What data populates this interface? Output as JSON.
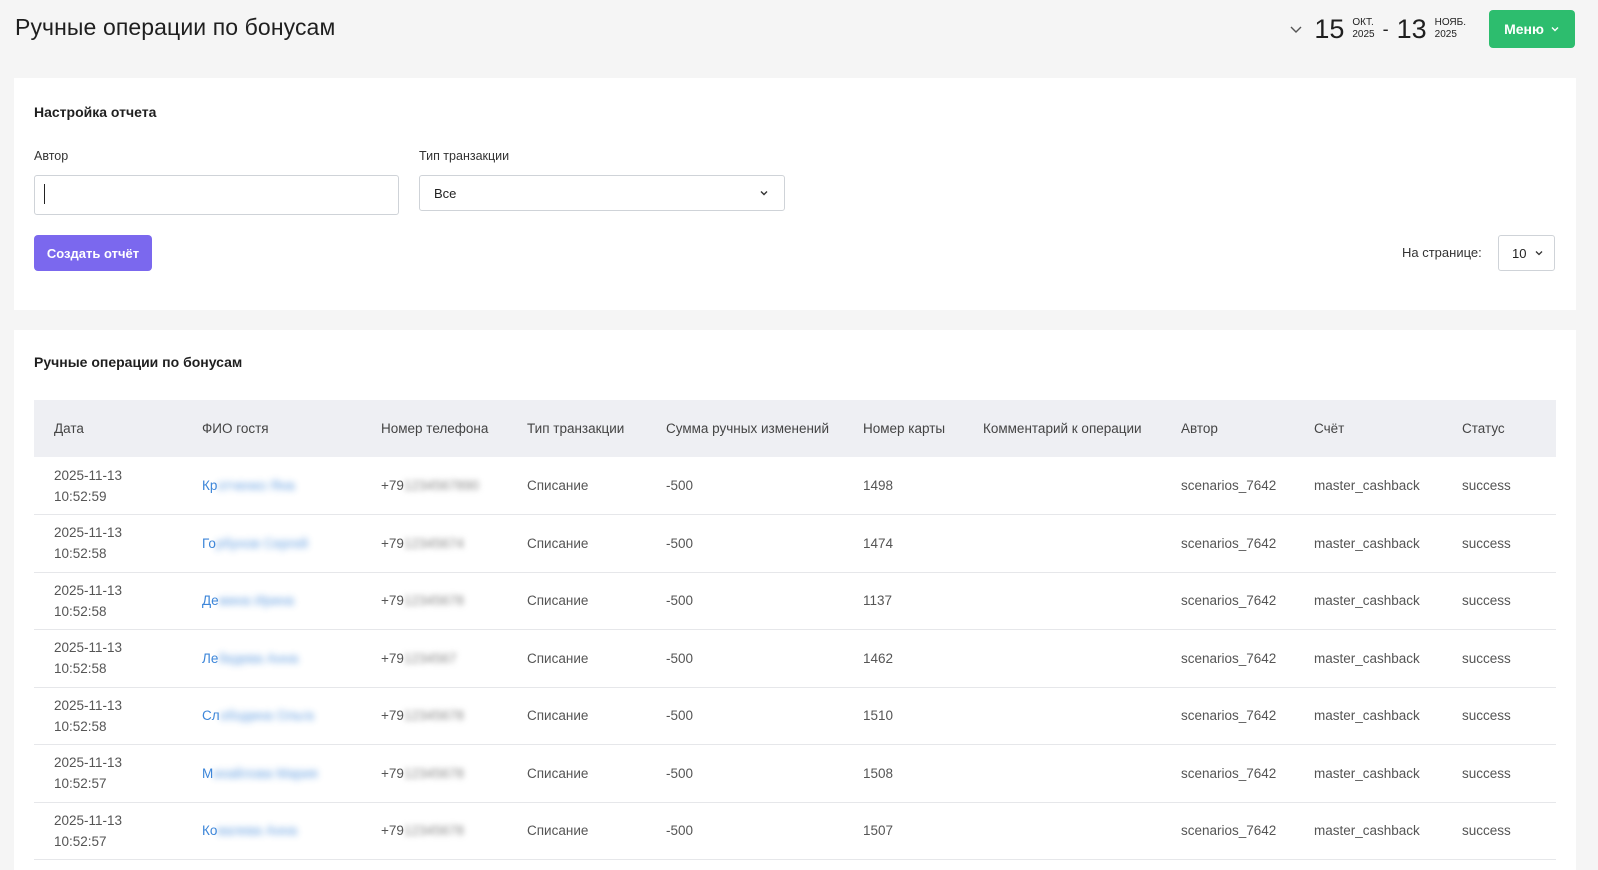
{
  "header": {
    "title": "Ручные операции по бонусам",
    "date_from_day": "15",
    "date_from_month": "ОКТ.",
    "date_from_year": "2025",
    "date_to_day": "13",
    "date_to_month": "НОЯБ.",
    "date_to_year": "2025",
    "menu_label": "Меню"
  },
  "settings": {
    "title": "Настройка отчета",
    "author_label": "Автор",
    "author_value": "",
    "type_label": "Тип транзакции",
    "type_value": "Все",
    "create_label": "Создать отчёт",
    "per_page_label": "На странице:",
    "per_page_value": "10"
  },
  "report": {
    "title": "Ручные операции по бонусам",
    "columns": [
      "Дата",
      "ФИО гостя",
      "Номер телефона",
      "Тип транзакции",
      "Сумма ручных изменений",
      "Номер карты",
      "Комментарий к операции",
      "Автор",
      "Счёт",
      "Статус"
    ],
    "rows": [
      {
        "date": "2025-11-13",
        "time": "10:52:59",
        "name_visible": "Кр",
        "name_blurred": "отченко Яна",
        "phone_visible": "+79",
        "phone_blurred": "1234567890",
        "type": "Списание",
        "sum": "-500",
        "card": "1498",
        "comment": "",
        "author": "scenarios_7642",
        "account": "master_cashback",
        "status": "success"
      },
      {
        "date": "2025-11-13",
        "time": "10:52:58",
        "name_visible": "Го",
        "name_blurred": "рбунов Сергей",
        "phone_visible": "+79",
        "phone_blurred": "12345674",
        "type": "Списание",
        "sum": "-500",
        "card": "1474",
        "comment": "",
        "author": "scenarios_7642",
        "account": "master_cashback",
        "status": "success"
      },
      {
        "date": "2025-11-13",
        "time": "10:52:58",
        "name_visible": "Де",
        "name_blurred": "мина Ирина",
        "phone_visible": "+79",
        "phone_blurred": "12345678",
        "type": "Списание",
        "sum": "-500",
        "card": "1137",
        "comment": "",
        "author": "scenarios_7642",
        "account": "master_cashback",
        "status": "success"
      },
      {
        "date": "2025-11-13",
        "time": "10:52:58",
        "name_visible": "Ле",
        "name_blurred": "бедева Анна",
        "phone_visible": "+79",
        "phone_blurred": "1234567",
        "type": "Списание",
        "sum": "-500",
        "card": "1462",
        "comment": "",
        "author": "scenarios_7642",
        "account": "master_cashback",
        "status": "success"
      },
      {
        "date": "2025-11-13",
        "time": "10:52:58",
        "name_visible": "Сл",
        "name_blurred": "ободина Ольга",
        "phone_visible": "+79",
        "phone_blurred": "12345678",
        "type": "Списание",
        "sum": "-500",
        "card": "1510",
        "comment": "",
        "author": "scenarios_7642",
        "account": "master_cashback",
        "status": "success"
      },
      {
        "date": "2025-11-13",
        "time": "10:52:57",
        "name_visible": "М",
        "name_blurred": "ихайлова Мария",
        "phone_visible": "+79",
        "phone_blurred": "12345678",
        "type": "Списание",
        "sum": "-500",
        "card": "1508",
        "comment": "",
        "author": "scenarios_7642",
        "account": "master_cashback",
        "status": "success"
      },
      {
        "date": "2025-11-13",
        "time": "10:52:57",
        "name_visible": "Ко",
        "name_blurred": "валева Анна",
        "phone_visible": "+79",
        "phone_blurred": "12345678",
        "type": "Списание",
        "sum": "-500",
        "card": "1507",
        "comment": "",
        "author": "scenarios_7642",
        "account": "master_cashback",
        "status": "success"
      }
    ]
  },
  "colors": {
    "menu_button": "#2dbd6e",
    "create_button": "#7b68ee",
    "link": "#3d86d9",
    "table_header": "#eeeff3"
  }
}
